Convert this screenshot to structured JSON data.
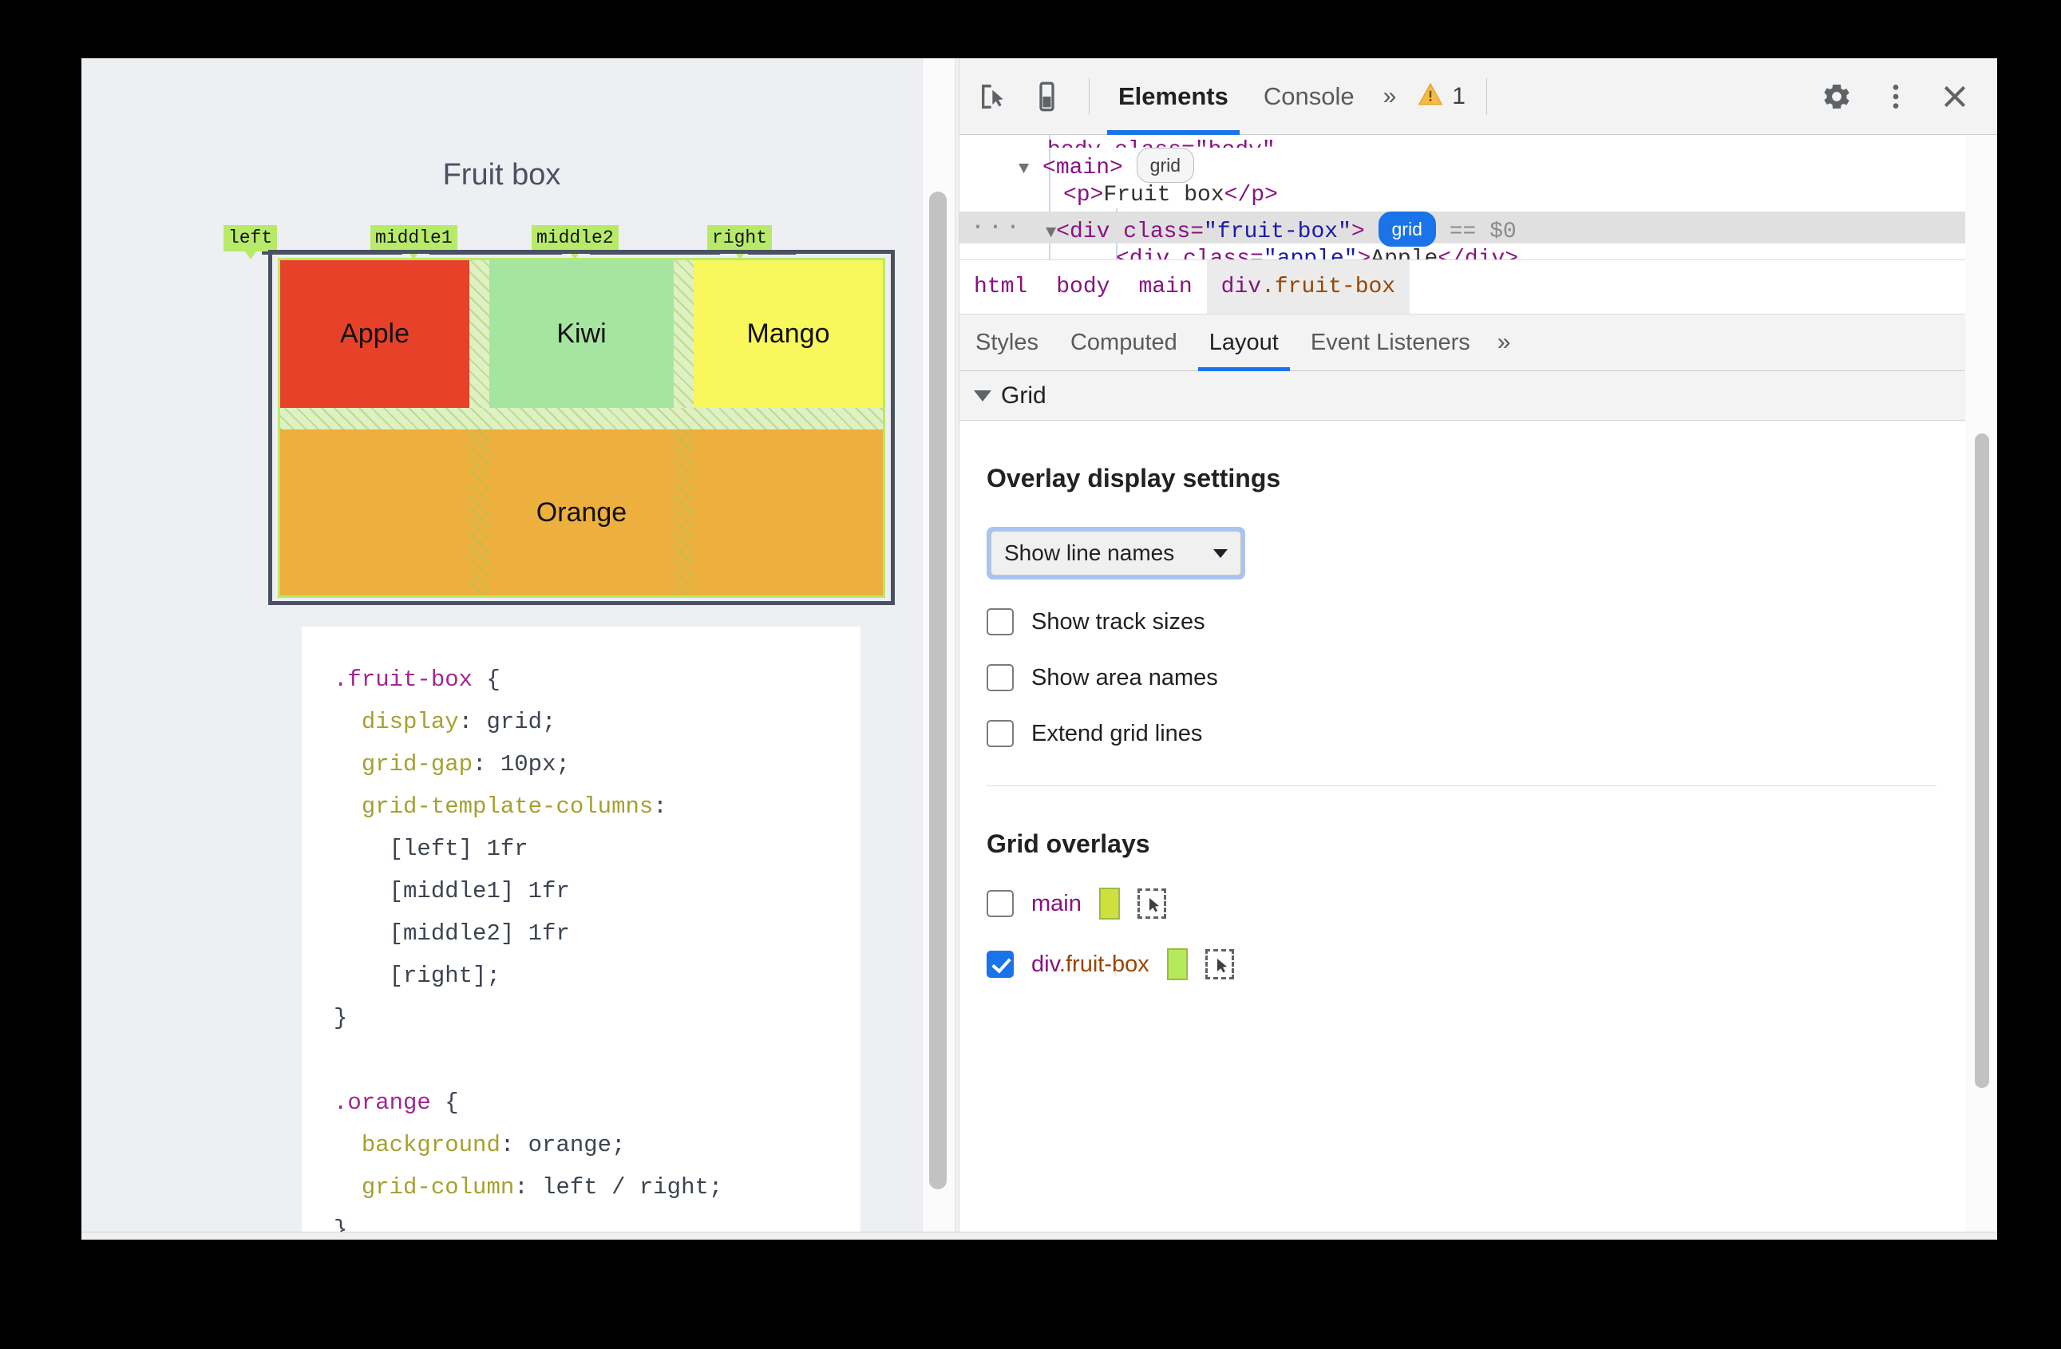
{
  "page": {
    "title": "Fruit box",
    "grid_line_names": [
      "left",
      "middle1",
      "middle2",
      "right"
    ],
    "cells": [
      {
        "label": "Apple",
        "color": "#e8412a"
      },
      {
        "label": "Kiwi",
        "color": "#a6e5a0"
      },
      {
        "label": "Mango",
        "color": "#f8f75b"
      },
      {
        "label": "Orange",
        "color": "#edaf3e"
      }
    ],
    "code": {
      "rule1": {
        "selector": ".fruit-box",
        "open": " {",
        "lines": [
          {
            "prop": "display",
            "value": " grid;"
          },
          {
            "prop": "grid-gap",
            "value": " 10px;"
          },
          {
            "prop": "grid-template-columns",
            "value": ""
          }
        ],
        "cont": [
          "[left] 1fr",
          "[middle1] 1fr",
          "[middle2] 1fr",
          "[right];"
        ],
        "close": "}"
      },
      "rule2": {
        "selector": ".orange",
        "open": " {",
        "lines": [
          {
            "prop": "background",
            "value": " orange;"
          },
          {
            "prop": "grid-column",
            "value": " left / right;"
          }
        ],
        "close": "}"
      }
    }
  },
  "devtools": {
    "toolbar": {
      "inspect_icon": "inspect-element-icon",
      "device_icon": "device-toolbar-icon",
      "tabs": [
        {
          "label": "Elements",
          "active": true
        },
        {
          "label": "Console",
          "active": false
        }
      ],
      "more_tabs": "»",
      "warning_icon": "warning-triangle-icon",
      "warning_count": "1",
      "settings_icon": "gear-icon",
      "more_icon": "kebab-menu-icon",
      "close_icon": "close-icon"
    },
    "dom_tree": {
      "lines": [
        {
          "kind": "cut",
          "text": "body class=\"body\""
        },
        {
          "kind": "main",
          "tag": "<main>",
          "badge": "grid"
        },
        {
          "kind": "p",
          "open": "<p>",
          "text": "Fruit box",
          "close": "</p>"
        },
        {
          "kind": "selected",
          "open": "<div class=",
          "quote1": "\"fruit-box\"",
          "close": ">",
          "badge": "grid",
          "suffix": "== $0",
          "dots": "···"
        },
        {
          "kind": "child",
          "open": "<div class=",
          "quote1": "\"apple\"",
          "gt": ">",
          "text": "Apple",
          "close": "</div>"
        }
      ]
    },
    "breadcrumbs": [
      {
        "label": "html",
        "cls": "",
        "active": false
      },
      {
        "label": "body",
        "cls": "",
        "active": false
      },
      {
        "label": "main",
        "cls": "",
        "active": false
      },
      {
        "label": "div",
        "cls": ".fruit-box",
        "active": true
      }
    ],
    "sidebar_tabs": [
      {
        "label": "Styles",
        "active": false
      },
      {
        "label": "Computed",
        "active": false
      },
      {
        "label": "Layout",
        "active": true
      },
      {
        "label": "Event Listeners",
        "active": false
      }
    ],
    "sidebar_more": "»",
    "grid_section": {
      "header": "Grid",
      "overlay_settings_title": "Overlay display settings",
      "dropdown_value": "Show line names",
      "checkboxes": [
        {
          "label": "Show track sizes",
          "checked": false
        },
        {
          "label": "Show area names",
          "checked": false
        },
        {
          "label": "Extend grid lines",
          "checked": false
        }
      ],
      "overlays_title": "Grid overlays",
      "overlays": [
        {
          "name": "main",
          "cls": "",
          "checked": false,
          "color": "#cfe03e"
        },
        {
          "name": "div",
          "cls": ".fruit-box",
          "checked": true,
          "color": "#b5ea5c"
        }
      ]
    }
  },
  "colors": {
    "accent": "#1a73e8",
    "grid_label_bg": "#b8ea6a",
    "grid_border": "#4a5163"
  }
}
